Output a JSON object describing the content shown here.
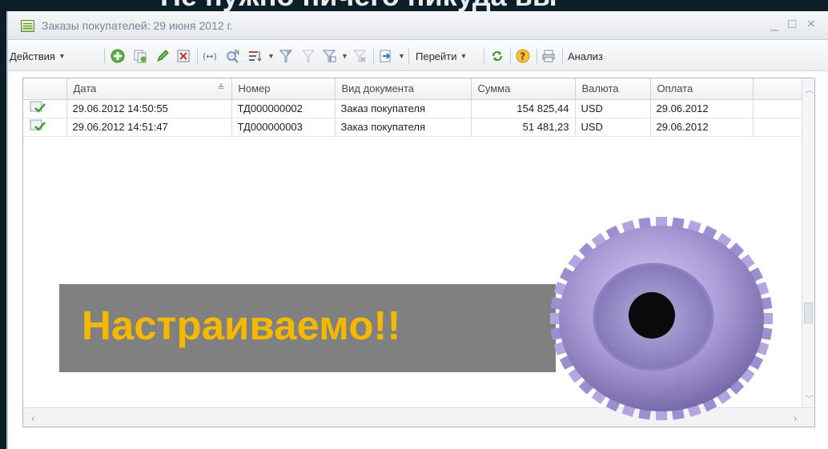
{
  "slide": {
    "title": "Не нужно ничего никуда вы"
  },
  "window": {
    "title": "Заказы покупателей: 29 июня 2012 г.",
    "minimize": "_",
    "maximize": "□",
    "close": "×"
  },
  "toolbar": {
    "actions_label": "Действия",
    "goto_label": "Перейти",
    "analysis_label": "Анализ",
    "icons": [
      "add-icon",
      "copy-icon",
      "edit-icon",
      "delete-icon",
      "interval-icon",
      "find-icon",
      "sort-icon",
      "filter-icon",
      "filter-clear-icon",
      "filter-list-icon",
      "filter-remove-icon",
      "output-icon",
      "refresh-icon",
      "help-icon",
      "print-icon"
    ]
  },
  "table": {
    "columns": [
      "Дата",
      "Номер",
      "Вид документа",
      "Сумма",
      "Валюта",
      "Оплата"
    ],
    "rows": [
      {
        "date": "29.06.2012 14:50:55",
        "number": "ТД000000002",
        "doc_type": "Заказ покупателя",
        "amount": "154 825,44",
        "currency": "USD",
        "payment": "29.06.2012"
      },
      {
        "date": "29.06.2012 14:51:47",
        "number": "ТД000000003",
        "doc_type": "Заказ покупателя",
        "amount": "51 481,23",
        "currency": "USD",
        "payment": "29.06.2012"
      }
    ]
  },
  "overlay": {
    "text": "Настраиваемо!!"
  },
  "colors": {
    "overlay_text": "#f5b800",
    "gear": "#a99ad6",
    "slide_bg": "#0c1f28"
  }
}
